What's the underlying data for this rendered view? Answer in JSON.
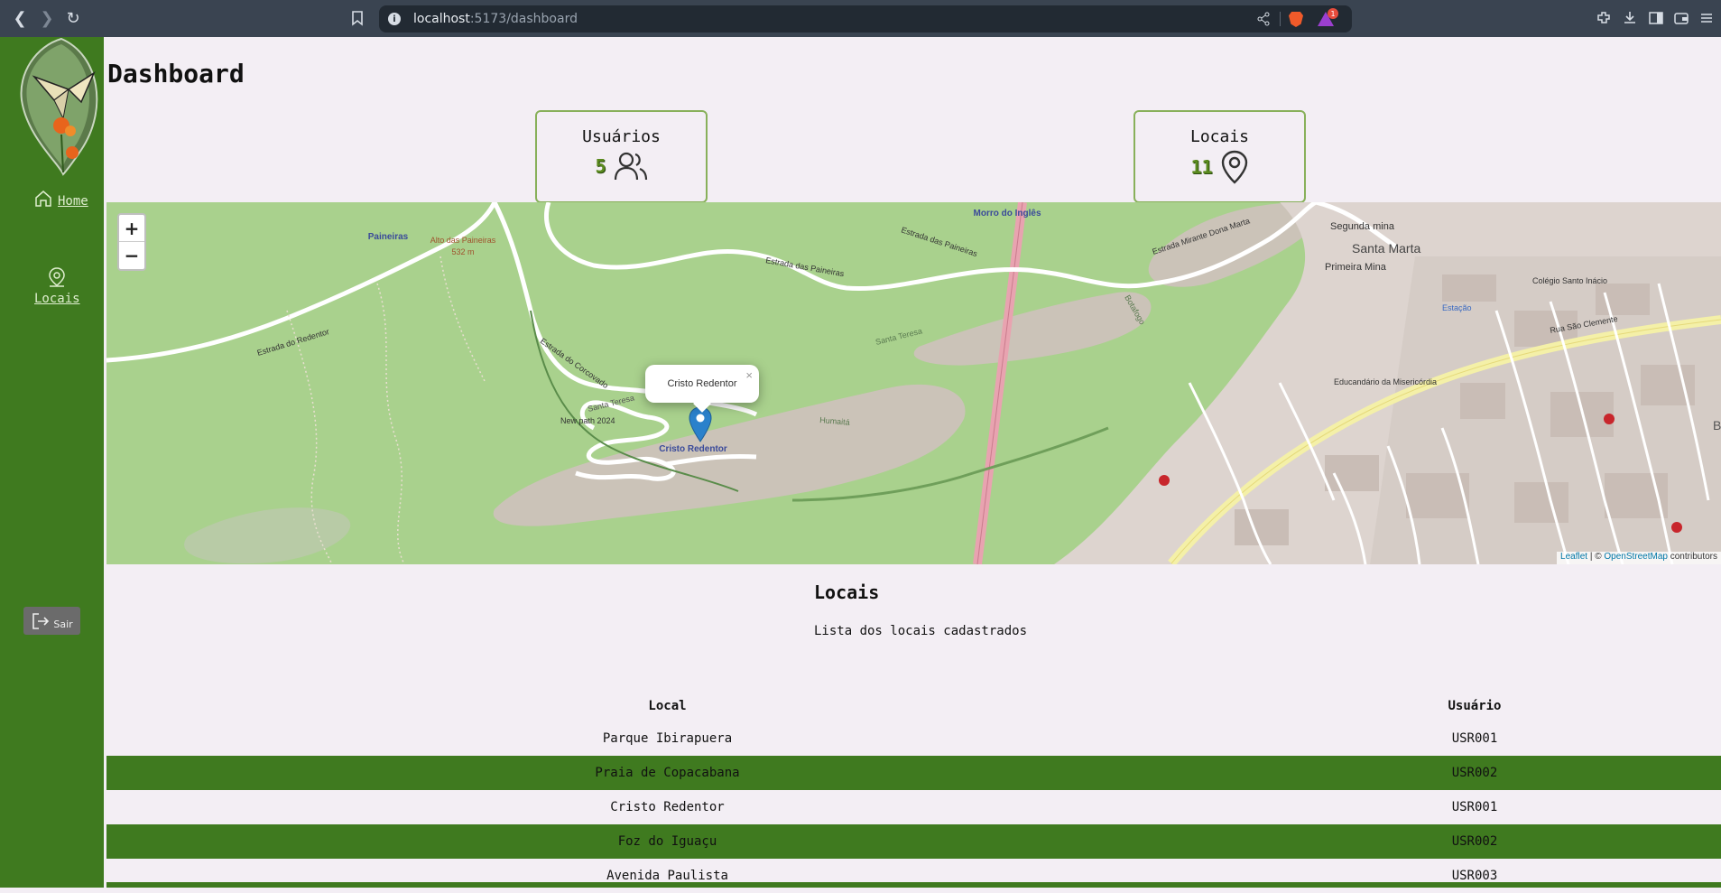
{
  "browser": {
    "url_host": "localhost",
    "url_path": ":5173/dashboard",
    "notification_count": "1"
  },
  "sidebar": {
    "home_label": "Home",
    "locais_label": "Locais",
    "exit_label": "Sair"
  },
  "page": {
    "title": "Dashboard"
  },
  "stats": {
    "users": {
      "label": "Usuários",
      "value": "5"
    },
    "places": {
      "label": "Locais",
      "value": "11"
    }
  },
  "map": {
    "popup_text": "Cristo Redentor",
    "attribution_leaflet": "Leaflet",
    "attribution_sep": " | © ",
    "attribution_osm": "OpenStreetMap",
    "attribution_tail": " contributors",
    "labels": {
      "paineiras": "Paineiras",
      "alto": "Alto das Paineiras",
      "alto_elev": "532 m",
      "morro": "Morro do Inglês",
      "santa_marta": "Santa Marta",
      "segunda_mina": "Segunda mina",
      "primeira_mina": "Primeira Mina",
      "estacao": "Estação",
      "estrada_redentor": "Estrada do Redentor",
      "estrada_paineiras": "Estrada das Paineiras",
      "estrada_corcovado": "Estrada do Corcovado",
      "santa_teresa": "Santa Teresa",
      "new_path": "New path 2024",
      "cristo_label": "Cristo Redentor",
      "humaita": "Humaitá",
      "rua_sao_clemente": "Rua São Clemente",
      "educandario": "Educandário da Misericórdia",
      "colegio": "Colégio Santo Inácio",
      "botafogo": "Botafogo",
      "mirante": "Estrada Mirante Dona Marta"
    }
  },
  "places_section": {
    "title": "Locais",
    "subtitle": "Lista dos locais cadastrados",
    "columns": [
      "Local",
      "Usuário"
    ],
    "rows": [
      {
        "local": "Parque Ibirapuera",
        "user": "USR001"
      },
      {
        "local": "Praia de Copacabana",
        "user": "USR002"
      },
      {
        "local": "Cristo Redentor",
        "user": "USR001"
      },
      {
        "local": "Foz do Iguaçu",
        "user": "USR002"
      },
      {
        "local": "Avenida Paulista",
        "user": "USR003"
      }
    ]
  },
  "colors": {
    "sidebar": "#3f7a1f",
    "background": "#f3eef4",
    "card_border": "#88b05a",
    "map_forest": "#a4cf86",
    "marker": "#2a81cb"
  }
}
